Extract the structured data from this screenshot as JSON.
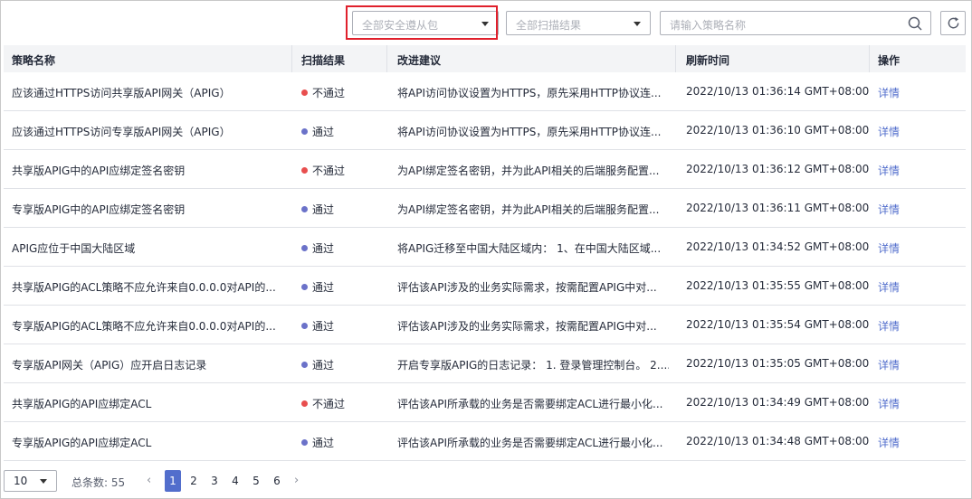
{
  "toolbar": {
    "filter_package": "全部安全遵从包",
    "filter_result": "全部扫描结果",
    "search_placeholder": "请输入策略名称"
  },
  "table": {
    "headers": [
      "策略名称",
      "扫描结果",
      "改进建议",
      "刷新时间",
      "操作"
    ],
    "rows": [
      {
        "name": "应该通过HTTPS访问共享版API网关（APIG）",
        "status": "不通过",
        "status_color": "#e84e4e",
        "suggestion": "将API访问协议设置为HTTPS，原先采用HTTP协议连...",
        "time": "2022/10/13 01:36:14 GMT+08:00",
        "op": "详情"
      },
      {
        "name": "应该通过HTTPS访问专享版API网关（APIG）",
        "status": "通过",
        "status_color": "#6b72c9",
        "suggestion": "将API访问协议设置为HTTPS，原先采用HTTP协议连...",
        "time": "2022/10/13 01:36:10 GMT+08:00",
        "op": "详情"
      },
      {
        "name": "共享版APIG中的API应绑定签名密钥",
        "status": "不通过",
        "status_color": "#e84e4e",
        "suggestion": "为API绑定签名密钥，并为此API相关的后端服务配置...",
        "time": "2022/10/13 01:36:12 GMT+08:00",
        "op": "详情"
      },
      {
        "name": "专享版APIG中的API应绑定签名密钥",
        "status": "通过",
        "status_color": "#6b72c9",
        "suggestion": "为API绑定签名密钥，并为此API相关的后端服务配置...",
        "time": "2022/10/13 01:36:11 GMT+08:00",
        "op": "详情"
      },
      {
        "name": "APIG应位于中国大陆区域",
        "status": "通过",
        "status_color": "#6b72c9",
        "suggestion": "将APIG迁移至中国大陆区域内： 1、在中国大陆区域...",
        "time": "2022/10/13 01:34:52 GMT+08:00",
        "op": "详情"
      },
      {
        "name": "共享版APIG的ACL策略不应允许来自0.0.0.0对API的...",
        "status": "通过",
        "status_color": "#6b72c9",
        "suggestion": "评估该API涉及的业务实际需求，按需配置APIG中对...",
        "time": "2022/10/13 01:35:55 GMT+08:00",
        "op": "详情"
      },
      {
        "name": "专享版APIG的ACL策略不应允许来自0.0.0.0对API的...",
        "status": "通过",
        "status_color": "#6b72c9",
        "suggestion": "评估该API涉及的业务实际需求，按需配置APIG中对...",
        "time": "2022/10/13 01:35:54 GMT+08:00",
        "op": "详情"
      },
      {
        "name": "专享版API网关（APIG）应开启日志记录",
        "status": "通过",
        "status_color": "#6b72c9",
        "suggestion": "开启专享版APIG的日志记录： 1. 登录管理控制台。 2....",
        "time": "2022/10/13 01:35:05 GMT+08:00",
        "op": "详情"
      },
      {
        "name": "共享版APIG的API应绑定ACL",
        "status": "不通过",
        "status_color": "#e84e4e",
        "suggestion": "评估该API所承载的业务是否需要绑定ACL进行最小化...",
        "time": "2022/10/13 01:34:49 GMT+08:00",
        "op": "详情"
      },
      {
        "name": "专享版APIG的API应绑定ACL",
        "status": "通过",
        "status_color": "#6b72c9",
        "suggestion": "评估该API所承载的业务是否需要绑定ACL进行最小化...",
        "time": "2022/10/13 01:34:48 GMT+08:00",
        "op": "详情"
      }
    ]
  },
  "pagination": {
    "page_size": "10",
    "total_label": "总条数: 55",
    "pages": [
      "1",
      "2",
      "3",
      "4",
      "5",
      "6"
    ],
    "current": "1",
    "prev": "‹",
    "next": "›"
  },
  "icons": {
    "search": "search-icon",
    "refresh": "refresh-icon",
    "dropdown": "chevron-down-icon"
  },
  "colors": {
    "fail": "#e84e4e",
    "pass": "#6b72c9",
    "link": "#526ecc",
    "highlight_box": "#e0202c"
  }
}
